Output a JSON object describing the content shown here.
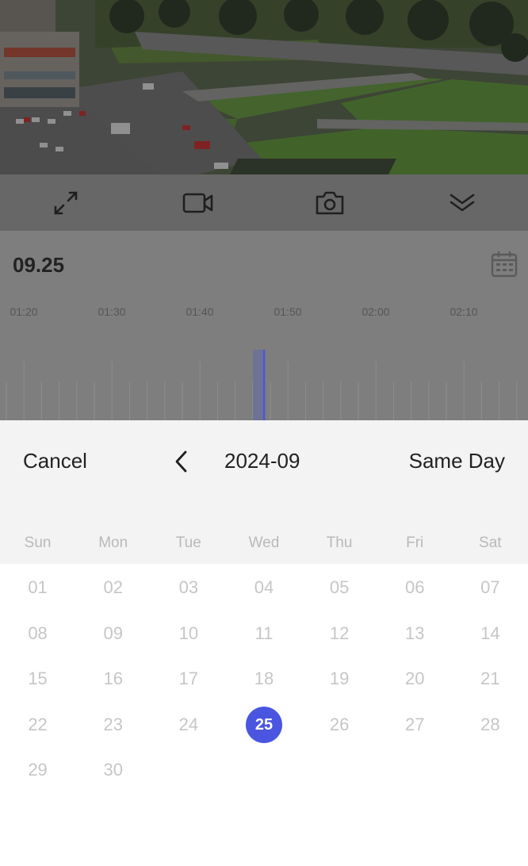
{
  "video": {
    "description_icon": "camera-feed"
  },
  "controls": [
    {
      "name": "fullscreen-icon",
      "label": ""
    },
    {
      "name": "record-video-icon",
      "label": ""
    },
    {
      "name": "snapshot-camera-icon",
      "label": ""
    },
    {
      "name": "collapse-chevron-icon",
      "label": ""
    }
  ],
  "playback": {
    "date": "09.25",
    "time_labels": [
      "01:20",
      "01:30",
      "01:40",
      "01:50",
      "02:00",
      "02:10"
    ],
    "accent_color": "#4a55e0"
  },
  "picker": {
    "cancel_label": "Cancel",
    "month": "2024-09",
    "same_day_label": "Same Day",
    "weekdays": [
      "Sun",
      "Mon",
      "Tue",
      "Wed",
      "Thu",
      "Fri",
      "Sat"
    ],
    "first_weekday_index": 0,
    "days": [
      "01",
      "02",
      "03",
      "04",
      "05",
      "06",
      "07",
      "08",
      "09",
      "10",
      "11",
      "12",
      "13",
      "14",
      "15",
      "16",
      "17",
      "18",
      "19",
      "20",
      "21",
      "22",
      "23",
      "24",
      "25",
      "26",
      "27",
      "28",
      "29",
      "30"
    ],
    "selected_day": "25",
    "selected_color": "#4a55e0"
  }
}
